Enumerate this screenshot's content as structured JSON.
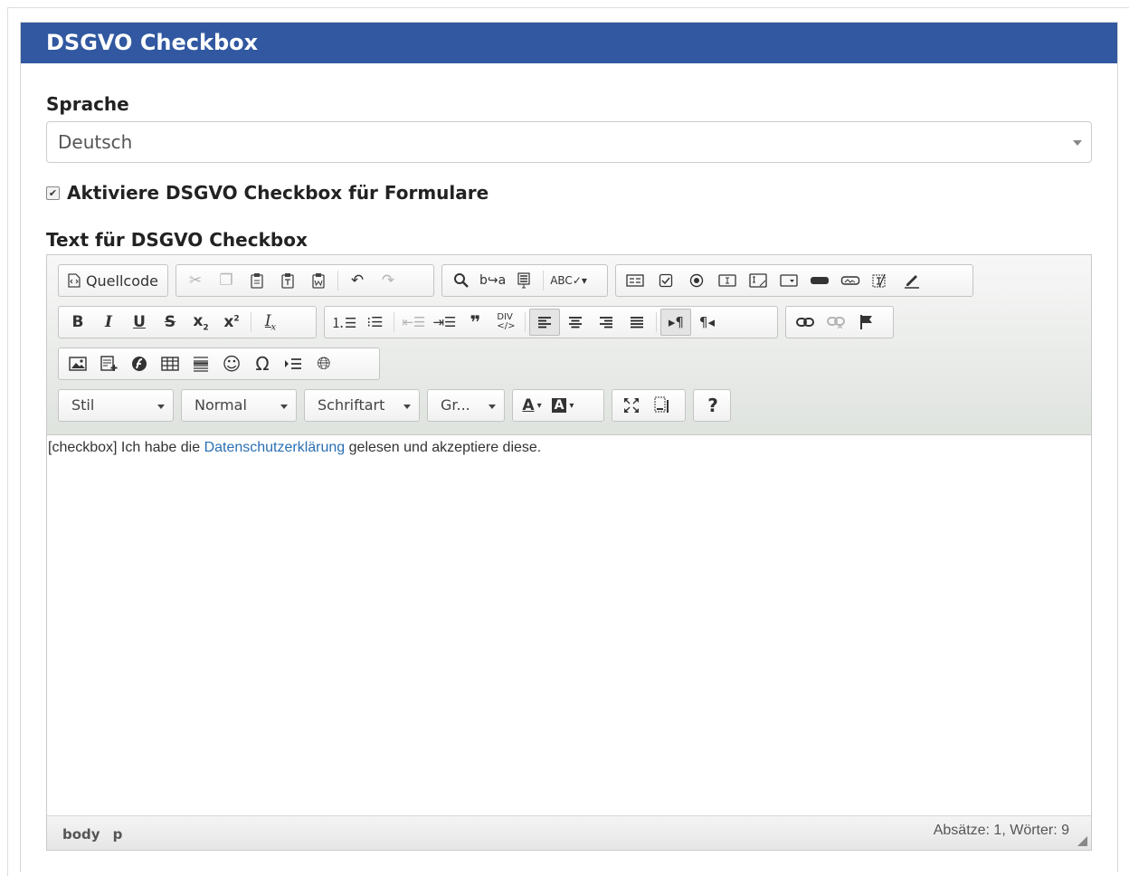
{
  "panel": {
    "title": "DSGVO Checkbox"
  },
  "language": {
    "label": "Sprache",
    "selected": "Deutsch"
  },
  "activate": {
    "label": "Aktiviere DSGVO Checkbox für Formulare",
    "checked": true
  },
  "editor": {
    "label": "Text für DSGVO Checkbox",
    "source_label": "Quellcode",
    "combos": {
      "style": "Stil",
      "format": "Normal",
      "font": "Schriftart",
      "size": "Gr..."
    },
    "help_label": "?",
    "content": {
      "before": "[checkbox] Ich habe die ",
      "link": "Datenschutzerklärung",
      "after": " gelesen und akzeptiere diese."
    },
    "status": {
      "path": [
        "body",
        "p"
      ],
      "counter": "Absätze: 1, Wörter: 9"
    }
  },
  "colors": {
    "header_bg": "#3158a0",
    "link": "#2a6fb4"
  }
}
